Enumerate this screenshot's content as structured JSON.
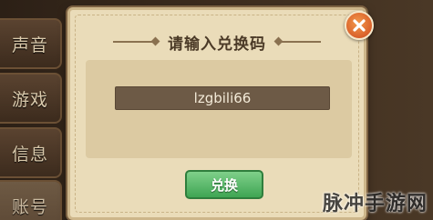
{
  "side_tabs": [
    "声音",
    "游戏",
    "信息",
    "账号"
  ],
  "dialog": {
    "title": "请输入兑换码",
    "code_value": "lzgbili66",
    "redeem_label": "兑换"
  },
  "icons": {
    "close": "close-icon"
  },
  "watermark": "脉冲手游网",
  "colors": {
    "dialog_bg": "#eadcb9",
    "input_bg": "#6d5a46",
    "button_green": "#3fa553",
    "close_orange": "#d9602a"
  }
}
